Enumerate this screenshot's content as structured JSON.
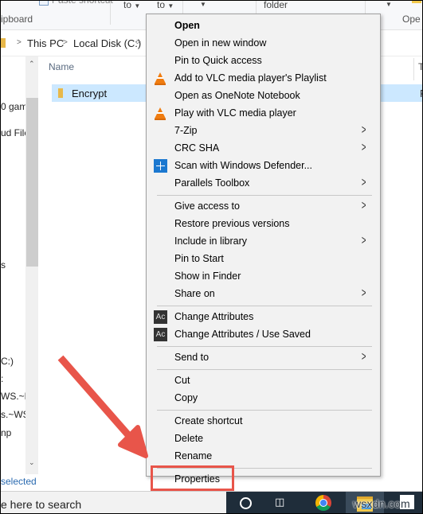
{
  "ribbon": {
    "paste_shortcut_partial": "Paste shortcut",
    "move_to": "to",
    "copy_to": "to",
    "new_folder": "folder",
    "clipboard_group": "ipboard",
    "open_group": "Ope"
  },
  "address_bar": {
    "crumbs": [
      "This PC",
      "Local Disk (C:)"
    ]
  },
  "nav_pane": {
    "items": [
      "0 gam",
      "ud File",
      "s",
      "C:)",
      ":",
      "WS.~B",
      "s.~WS",
      "np"
    ]
  },
  "file_list": {
    "column_name": "Name",
    "column_type_partial": "T",
    "rows": [
      {
        "name": "Encrypt",
        "type_partial": "F",
        "selected": true
      }
    ]
  },
  "status_bar": {
    "text": "selected"
  },
  "taskbar": {
    "search_text": "e here to search",
    "watermark": "wsxdn.com"
  },
  "context_menu": {
    "sections": [
      [
        {
          "label": "Open",
          "bold": true,
          "icon": null,
          "submenu": false
        },
        {
          "label": "Open in new window",
          "icon": null,
          "submenu": false
        },
        {
          "label": "Pin to Quick access",
          "icon": null,
          "submenu": false
        },
        {
          "label": "Add to VLC media player's Playlist",
          "icon": "vlc-icon",
          "submenu": false
        },
        {
          "label": "Open as OneNote Notebook",
          "icon": null,
          "submenu": false
        },
        {
          "label": "Play with VLC media player",
          "icon": "vlc-icon",
          "submenu": false
        },
        {
          "label": "7-Zip",
          "icon": null,
          "submenu": true
        },
        {
          "label": "CRC SHA",
          "icon": null,
          "submenu": true
        },
        {
          "label": "Scan with Windows Defender...",
          "icon": "windows-defender-icon",
          "submenu": false
        },
        {
          "label": "Parallels Toolbox",
          "icon": null,
          "submenu": true
        }
      ],
      [
        {
          "label": "Give access to",
          "icon": null,
          "submenu": true
        },
        {
          "label": "Restore previous versions",
          "icon": null,
          "submenu": false
        },
        {
          "label": "Include in library",
          "icon": null,
          "submenu": true
        },
        {
          "label": "Pin to Start",
          "icon": null,
          "submenu": false
        },
        {
          "label": "Show in Finder",
          "icon": null,
          "submenu": false
        },
        {
          "label": "Share on",
          "icon": null,
          "submenu": true
        }
      ],
      [
        {
          "label": "Change Attributes",
          "icon": "change-attributes-icon",
          "submenu": false
        },
        {
          "label": "Change Attributes / Use Saved",
          "icon": "change-attributes-icon",
          "submenu": false
        }
      ],
      [
        {
          "label": "Send to",
          "icon": null,
          "submenu": true
        }
      ],
      [
        {
          "label": "Cut",
          "icon": null,
          "submenu": false
        },
        {
          "label": "Copy",
          "icon": null,
          "submenu": false
        }
      ],
      [
        {
          "label": "Create shortcut",
          "icon": null,
          "submenu": false
        },
        {
          "label": "Delete",
          "icon": null,
          "submenu": false
        },
        {
          "label": "Rename",
          "icon": null,
          "submenu": false
        }
      ],
      [
        {
          "label": "Properties",
          "icon": null,
          "submenu": false,
          "highlighted": true
        }
      ]
    ],
    "ac_icon_text": "Ac"
  },
  "colors": {
    "annotation_red": "#e8554a",
    "selection_blue": "#cce8ff",
    "menu_bg": "#f2f2f2",
    "taskbar_bg": "#1f2d3a"
  }
}
